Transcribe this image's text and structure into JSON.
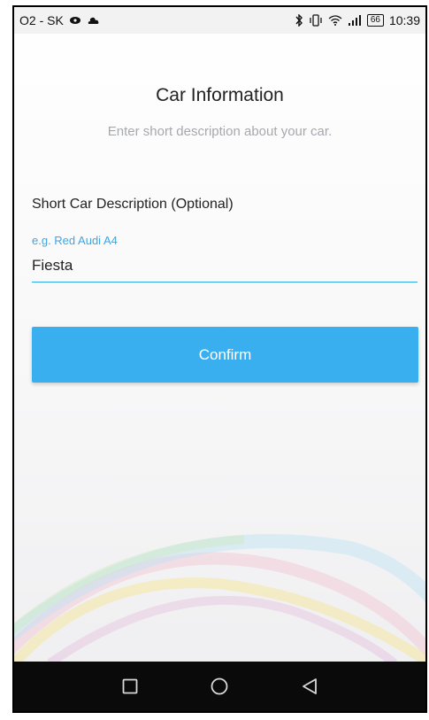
{
  "status_bar": {
    "carrier": "O2 - SK",
    "battery": "66",
    "time": "10:39"
  },
  "page": {
    "title": "Car Information",
    "subtitle": "Enter short description about your car."
  },
  "form": {
    "section_label": "Short Car Description (Optional)",
    "hint": "e.g. Red Audi A4",
    "value": "Fiesta"
  },
  "actions": {
    "confirm_label": "Confirm"
  },
  "colors": {
    "accent": "#3aaff0",
    "hint": "#3aa6e6"
  },
  "icons": {
    "nav": [
      "square-icon",
      "circle-icon",
      "triangle-back-icon"
    ]
  }
}
